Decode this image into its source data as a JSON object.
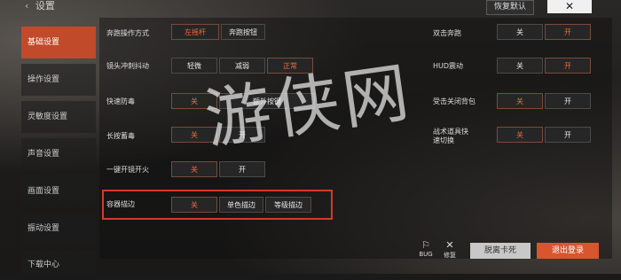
{
  "title": {
    "back_glyph": "‹",
    "label": "设置"
  },
  "buttons": {
    "reset": "恢复默认",
    "close_glyph": "✕",
    "unstuck": "脱离卡死",
    "logout": "退出登录"
  },
  "sidebar": {
    "items": [
      {
        "label": "基础设置",
        "active": true
      },
      {
        "label": "操作设置"
      },
      {
        "label": "灵敏度设置"
      },
      {
        "label": "声音设置"
      },
      {
        "label": "画面设置"
      },
      {
        "label": "振动设置"
      },
      {
        "label": "下载中心"
      }
    ]
  },
  "left_settings": [
    {
      "label": "奔跑操作方式",
      "options": [
        "左摇杆",
        "奔跑按钮"
      ],
      "selected": 0
    },
    {
      "label": "镜头冲刺抖动",
      "options": [
        "轻微",
        "减弱",
        "正常"
      ],
      "selected": 2
    },
    {
      "label": "快速防毒",
      "options": [
        "关",
        "额外按键"
      ],
      "selected": 0
    },
    {
      "label": "长按蓄毒",
      "options": [
        "关",
        "开"
      ],
      "selected": 0
    },
    {
      "label": "一键开镜开火",
      "options": [
        "关",
        "开"
      ],
      "selected": 0
    },
    {
      "label": "容器描边",
      "options": [
        "关",
        "单色描边",
        "等级描边"
      ],
      "selected": 0
    }
  ],
  "right_settings": [
    {
      "label": "双击奔跑",
      "options": [
        "关",
        "开"
      ],
      "selected": 1
    },
    {
      "label": "HUD震动",
      "options": [
        "关",
        "开"
      ],
      "selected": 1
    },
    {
      "label": "受击关闭背包",
      "options": [
        "关",
        "开"
      ],
      "selected": 0
    },
    {
      "label": "战术道具快速切换",
      "options": [
        "关",
        "开"
      ],
      "selected": 0
    }
  ],
  "bottom_icons": {
    "bug": "BUG",
    "repair": "修复"
  },
  "watermark": "游侠网",
  "colors": {
    "accent": "#c14a2a",
    "selected_text": "#f06a3a",
    "highlight_box": "#d33a2c"
  }
}
